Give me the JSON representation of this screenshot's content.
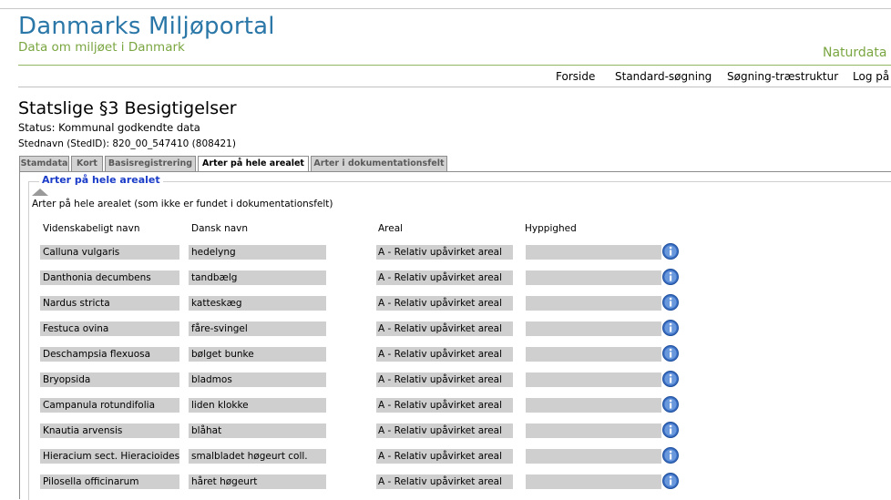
{
  "brand": {
    "title": "Danmarks Miljøportal",
    "subtitle": "Data om miljøet i Danmark",
    "section": "Naturdata"
  },
  "nav": {
    "items": [
      "Forside",
      "Standard-søgning",
      "Søgning-træstruktur",
      "Log på"
    ]
  },
  "page": {
    "title": "Statslige §3 Besigtigelser",
    "status": "Status: Kommunal godkendte data",
    "stednavn": "Stednavn (StedID): 820_00_547410 (808421)"
  },
  "tabs": [
    {
      "label": "Stamdata",
      "active": false
    },
    {
      "label": "Kort",
      "active": false
    },
    {
      "label": "Basisregistrering",
      "active": false
    },
    {
      "label": "Arter på hele arealet",
      "active": true
    },
    {
      "label": "Arter i dokumentationsfelt",
      "active": false
    }
  ],
  "section": {
    "legend": "Arter på hele arealet",
    "note": "Arter på hele arealet (som ikke er fundet i dokumentationsfelt)",
    "collapse_icon": "triangle-up-icon",
    "info_icon": "info-icon"
  },
  "table": {
    "headers": [
      "Videnskabeligt navn",
      "Dansk navn",
      "Areal",
      "Hyppighed"
    ],
    "rows": [
      {
        "latin": "Calluna vulgaris",
        "dansk": "hedelyng",
        "areal": "A - Relativ upåvirket areal",
        "hyppighed": ""
      },
      {
        "latin": "Danthonia decumbens",
        "dansk": "tandbælg",
        "areal": "A - Relativ upåvirket areal",
        "hyppighed": ""
      },
      {
        "latin": "Nardus stricta",
        "dansk": "katteskæg",
        "areal": "A - Relativ upåvirket areal",
        "hyppighed": ""
      },
      {
        "latin": "Festuca ovina",
        "dansk": "fåre-svingel",
        "areal": "A - Relativ upåvirket areal",
        "hyppighed": ""
      },
      {
        "latin": "Deschampsia flexuosa",
        "dansk": "bølget bunke",
        "areal": "A - Relativ upåvirket areal",
        "hyppighed": ""
      },
      {
        "latin": "Bryopsida",
        "dansk": "bladmos",
        "areal": "A - Relativ upåvirket areal",
        "hyppighed": ""
      },
      {
        "latin": "Campanula rotundifolia",
        "dansk": "liden klokke",
        "areal": "A - Relativ upåvirket areal",
        "hyppighed": ""
      },
      {
        "latin": "Knautia arvensis",
        "dansk": "blåhat",
        "areal": "A - Relativ upåvirket areal",
        "hyppighed": ""
      },
      {
        "latin": "Hieracium sect. Hieracioides",
        "dansk": "smalbladet høgeurt coll.",
        "areal": "A - Relativ upåvirket areal",
        "hyppighed": ""
      },
      {
        "latin": "Pilosella officinarum",
        "dansk": "håret høgeurt",
        "areal": "A - Relativ upåvirket areal",
        "hyppighed": ""
      }
    ]
  },
  "colors": {
    "brand_blue": "#2a77a8",
    "brand_green": "#7aa641",
    "legend_blue": "#1a3cc8",
    "cell_gray": "#cfcfcf"
  }
}
